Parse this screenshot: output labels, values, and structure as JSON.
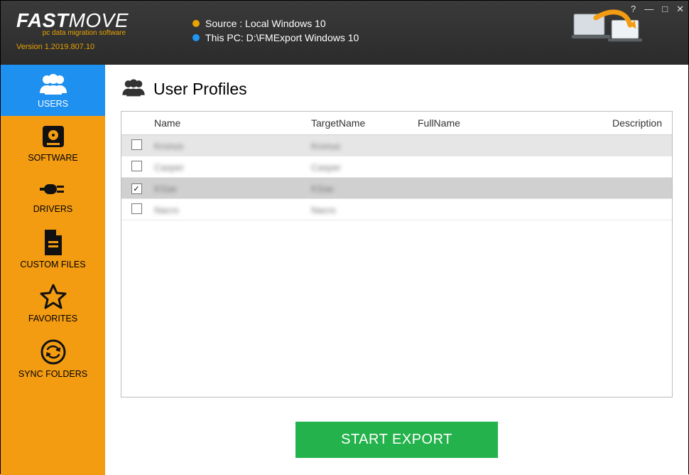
{
  "brand": {
    "name_bold": "FAST",
    "name_thin": "MOVE",
    "tagline": "pc data migration software",
    "version": "Version 1.2019.807.10"
  },
  "header_info": {
    "source_label": "Source : Local Windows 10",
    "thispc_label": "This PC: D:\\FMExport Windows 10"
  },
  "window_controls": {
    "help": "?",
    "minimize": "—",
    "maximize": "□",
    "close": "✕"
  },
  "sidebar": {
    "items": [
      {
        "key": "users",
        "label": "USERS",
        "active": true
      },
      {
        "key": "software",
        "label": "SOFTWARE",
        "active": false
      },
      {
        "key": "drivers",
        "label": "DRIVERS",
        "active": false
      },
      {
        "key": "customfiles",
        "label": "CUSTOM FILES",
        "active": false
      },
      {
        "key": "favorites",
        "label": "FAVORITES",
        "active": false
      },
      {
        "key": "syncfolders",
        "label": "SYNC FOLDERS",
        "active": false
      }
    ]
  },
  "page": {
    "title": "User Profiles"
  },
  "table": {
    "columns": {
      "name": "Name",
      "target": "TargetName",
      "full": "FullName",
      "desc": "Description"
    },
    "rows": [
      {
        "checked": false,
        "selected": false,
        "name": "Kronus",
        "target": "Kronus",
        "full": "",
        "desc": ""
      },
      {
        "checked": false,
        "selected": false,
        "name": "Casper",
        "target": "Casper",
        "full": "",
        "desc": ""
      },
      {
        "checked": true,
        "selected": true,
        "name": "KSae",
        "target": "KSae",
        "full": "",
        "desc": ""
      },
      {
        "checked": false,
        "selected": false,
        "name": "Nacro",
        "target": "Nacro",
        "full": "",
        "desc": ""
      }
    ]
  },
  "actions": {
    "start_export": "START EXPORT"
  },
  "colors": {
    "accent_orange": "#f39c12",
    "accent_blue": "#1e90f0",
    "accent_green": "#24b24c"
  }
}
